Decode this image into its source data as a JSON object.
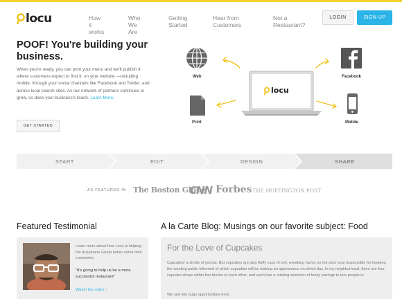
{
  "brand": {
    "logo_text": "locu",
    "accent": "#f2d230",
    "link_color": "#2ab4e8"
  },
  "nav": {
    "items": [
      "How it works",
      "Who We Are",
      "Getting Started",
      "Hear from Customers",
      "Not a Restaurant?"
    ],
    "login_label": "LOGIN",
    "signup_label": "SIGN UP"
  },
  "hero": {
    "title": "POOF! You're building your business.",
    "body": "When you're ready, you can print your menu and we'll publish it where customers expect to find it: on your website —including mobile, through your social channels like Facebook and Twitter, and across local search sites. As our network of partners continues to grow, so does your business's reach.",
    "learn_more": "Learn More.",
    "cta_label": "GET STARTED"
  },
  "diagram": {
    "web_label": "Web",
    "facebook_label": "Facebook",
    "print_label": "Print",
    "mobile_label": "Mobile",
    "screen_logo": "locu"
  },
  "steps": [
    "START",
    "EDIT",
    "DESIGN",
    "SHARE"
  ],
  "featured": {
    "label": "AS FEATURED IN",
    "outlets": [
      "The Boston Globe",
      "CNN",
      "Forbes",
      "THE HUFFINGTON POST"
    ]
  },
  "testimonial": {
    "heading": "Featured Testimonial",
    "intro": "Learn more about how Locu is helping the Acquitaine Group better serve their customers.",
    "quote": "\"It's going to help us be a more successful restaurant\"",
    "link": "Watch the video ›"
  },
  "blog": {
    "heading": "A la Carte Blog: Musings on our favorite subject: Food",
    "post_title": "For the Love of Cupcakes",
    "post_body": "Cupcakes' a stroke of genius. But cupcakes are also fluffy cups of evil, wreaking havoc on the poor soul responsible for keeping the wanting public informed of which cupcakes will be making an appearance on which day. In my neighborhood, there are four cupcake shops within five blocks of each other, and each has a rotating selection of funky pairings to lure people in.",
    "post_body2": "We see two huge opportunities here:"
  }
}
